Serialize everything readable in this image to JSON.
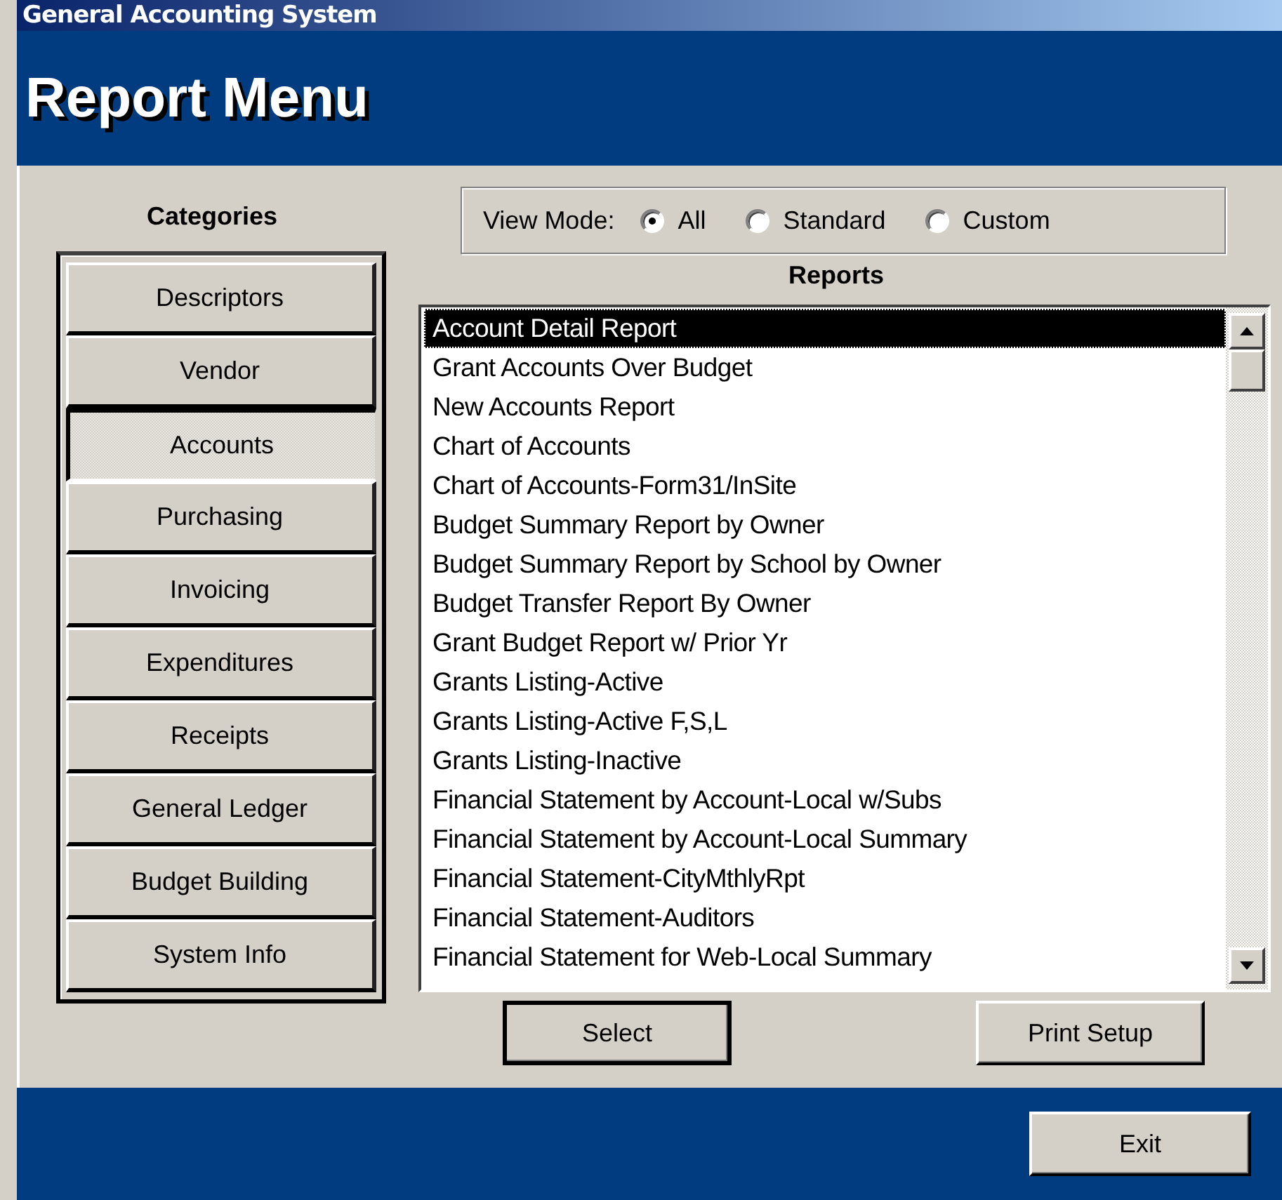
{
  "window": {
    "title": "General Accounting System"
  },
  "header": {
    "title": "Report Menu"
  },
  "categories": {
    "heading": "Categories",
    "items": [
      {
        "label": "Descriptors",
        "selected": false
      },
      {
        "label": "Vendor",
        "selected": false
      },
      {
        "label": "Accounts",
        "selected": true
      },
      {
        "label": "Purchasing",
        "selected": false
      },
      {
        "label": "Invoicing",
        "selected": false
      },
      {
        "label": "Expenditures",
        "selected": false
      },
      {
        "label": "Receipts",
        "selected": false
      },
      {
        "label": "General Ledger",
        "selected": false
      },
      {
        "label": "Budget Building",
        "selected": false
      },
      {
        "label": "System Info",
        "selected": false
      }
    ]
  },
  "view_mode": {
    "label": "View Mode:",
    "options": [
      {
        "label": "All",
        "selected": true
      },
      {
        "label": "Standard",
        "selected": false
      },
      {
        "label": "Custom",
        "selected": false
      }
    ]
  },
  "reports": {
    "heading": "Reports",
    "items": [
      {
        "label": "Account Detail Report",
        "selected": true
      },
      {
        "label": "Grant Accounts Over Budget",
        "selected": false
      },
      {
        "label": "New Accounts Report",
        "selected": false
      },
      {
        "label": "Chart of Accounts",
        "selected": false
      },
      {
        "label": "Chart of Accounts-Form31/InSite",
        "selected": false
      },
      {
        "label": "Budget Summary Report by Owner",
        "selected": false
      },
      {
        "label": "Budget Summary Report by School by Owner",
        "selected": false
      },
      {
        "label": "Budget Transfer Report By Owner",
        "selected": false
      },
      {
        "label": "Grant Budget Report w/ Prior Yr",
        "selected": false
      },
      {
        "label": "Grants Listing-Active",
        "selected": false
      },
      {
        "label": "Grants Listing-Active F,S,L",
        "selected": false
      },
      {
        "label": "Grants Listing-Inactive",
        "selected": false
      },
      {
        "label": "Financial Statement by Account-Local w/Subs",
        "selected": false
      },
      {
        "label": "Financial Statement by Account-Local Summary",
        "selected": false
      },
      {
        "label": "Financial Statement-CityMthlyRpt",
        "selected": false
      },
      {
        "label": "Financial Statement-Auditors",
        "selected": false
      },
      {
        "label": "Financial Statement for Web-Local Summary",
        "selected": false
      }
    ]
  },
  "buttons": {
    "select": "Select",
    "print_setup": "Print Setup",
    "exit": "Exit"
  }
}
